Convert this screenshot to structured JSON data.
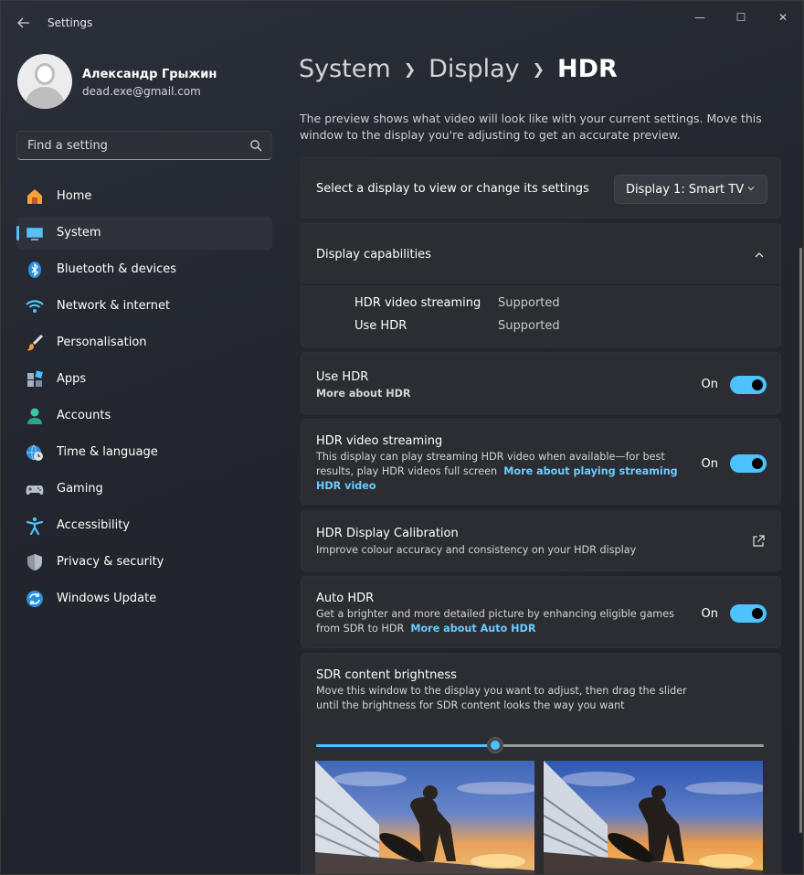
{
  "window": {
    "title": "Settings",
    "controls": {
      "minimize": "—",
      "maximize": "☐",
      "close": "✕"
    }
  },
  "profile": {
    "name": "Александр Грыжин",
    "email": "dead.exe@gmail.com"
  },
  "search": {
    "placeholder": "Find a setting"
  },
  "sidebar": {
    "items": [
      {
        "label": "Home",
        "icon": "home-icon",
        "active": false
      },
      {
        "label": "System",
        "icon": "system-icon",
        "active": true
      },
      {
        "label": "Bluetooth & devices",
        "icon": "bluetooth-icon",
        "active": false
      },
      {
        "label": "Network & internet",
        "icon": "wifi-icon",
        "active": false
      },
      {
        "label": "Personalisation",
        "icon": "brush-icon",
        "active": false
      },
      {
        "label": "Apps",
        "icon": "apps-icon",
        "active": false
      },
      {
        "label": "Accounts",
        "icon": "accounts-icon",
        "active": false
      },
      {
        "label": "Time & language",
        "icon": "globe-clock-icon",
        "active": false
      },
      {
        "label": "Gaming",
        "icon": "gamepad-icon",
        "active": false
      },
      {
        "label": "Accessibility",
        "icon": "accessibility-icon",
        "active": false
      },
      {
        "label": "Privacy & security",
        "icon": "shield-icon",
        "active": false
      },
      {
        "label": "Windows Update",
        "icon": "update-icon",
        "active": false
      }
    ]
  },
  "breadcrumb": [
    "System",
    "Display",
    "HDR"
  ],
  "intro": "The preview shows what video will look like with your current settings. Move this window to the display you're adjusting to get an accurate preview.",
  "display_select": {
    "label": "Select a display to view or change its settings",
    "value": "Display 1: Smart TV"
  },
  "capabilities": {
    "title": "Display capabilities",
    "rows": [
      {
        "key": "HDR video streaming",
        "value": "Supported"
      },
      {
        "key": "Use HDR",
        "value": "Supported"
      }
    ]
  },
  "use_hdr": {
    "title": "Use HDR",
    "link": "More about HDR",
    "state": "On"
  },
  "hdr_streaming": {
    "title": "HDR video streaming",
    "desc": "This display can play streaming HDR video when available—for best results, play HDR videos full screen",
    "link": "More about playing streaming HDR video",
    "state": "On"
  },
  "calibration": {
    "title": "HDR Display Calibration",
    "desc": "Improve colour accuracy and consistency on your HDR display"
  },
  "auto_hdr": {
    "title": "Auto HDR",
    "desc": "Get a brighter and more detailed picture by enhancing eligible games from SDR to HDR",
    "link": "More about Auto HDR",
    "state": "On"
  },
  "sdr": {
    "title": "SDR content brightness",
    "desc": "Move this window to the display you want to adjust, then drag the slider until the brightness for SDR content looks the way you want",
    "slider_value": 0.4
  },
  "colors": {
    "accent": "#4cc2ff",
    "link": "#6ccbff"
  }
}
